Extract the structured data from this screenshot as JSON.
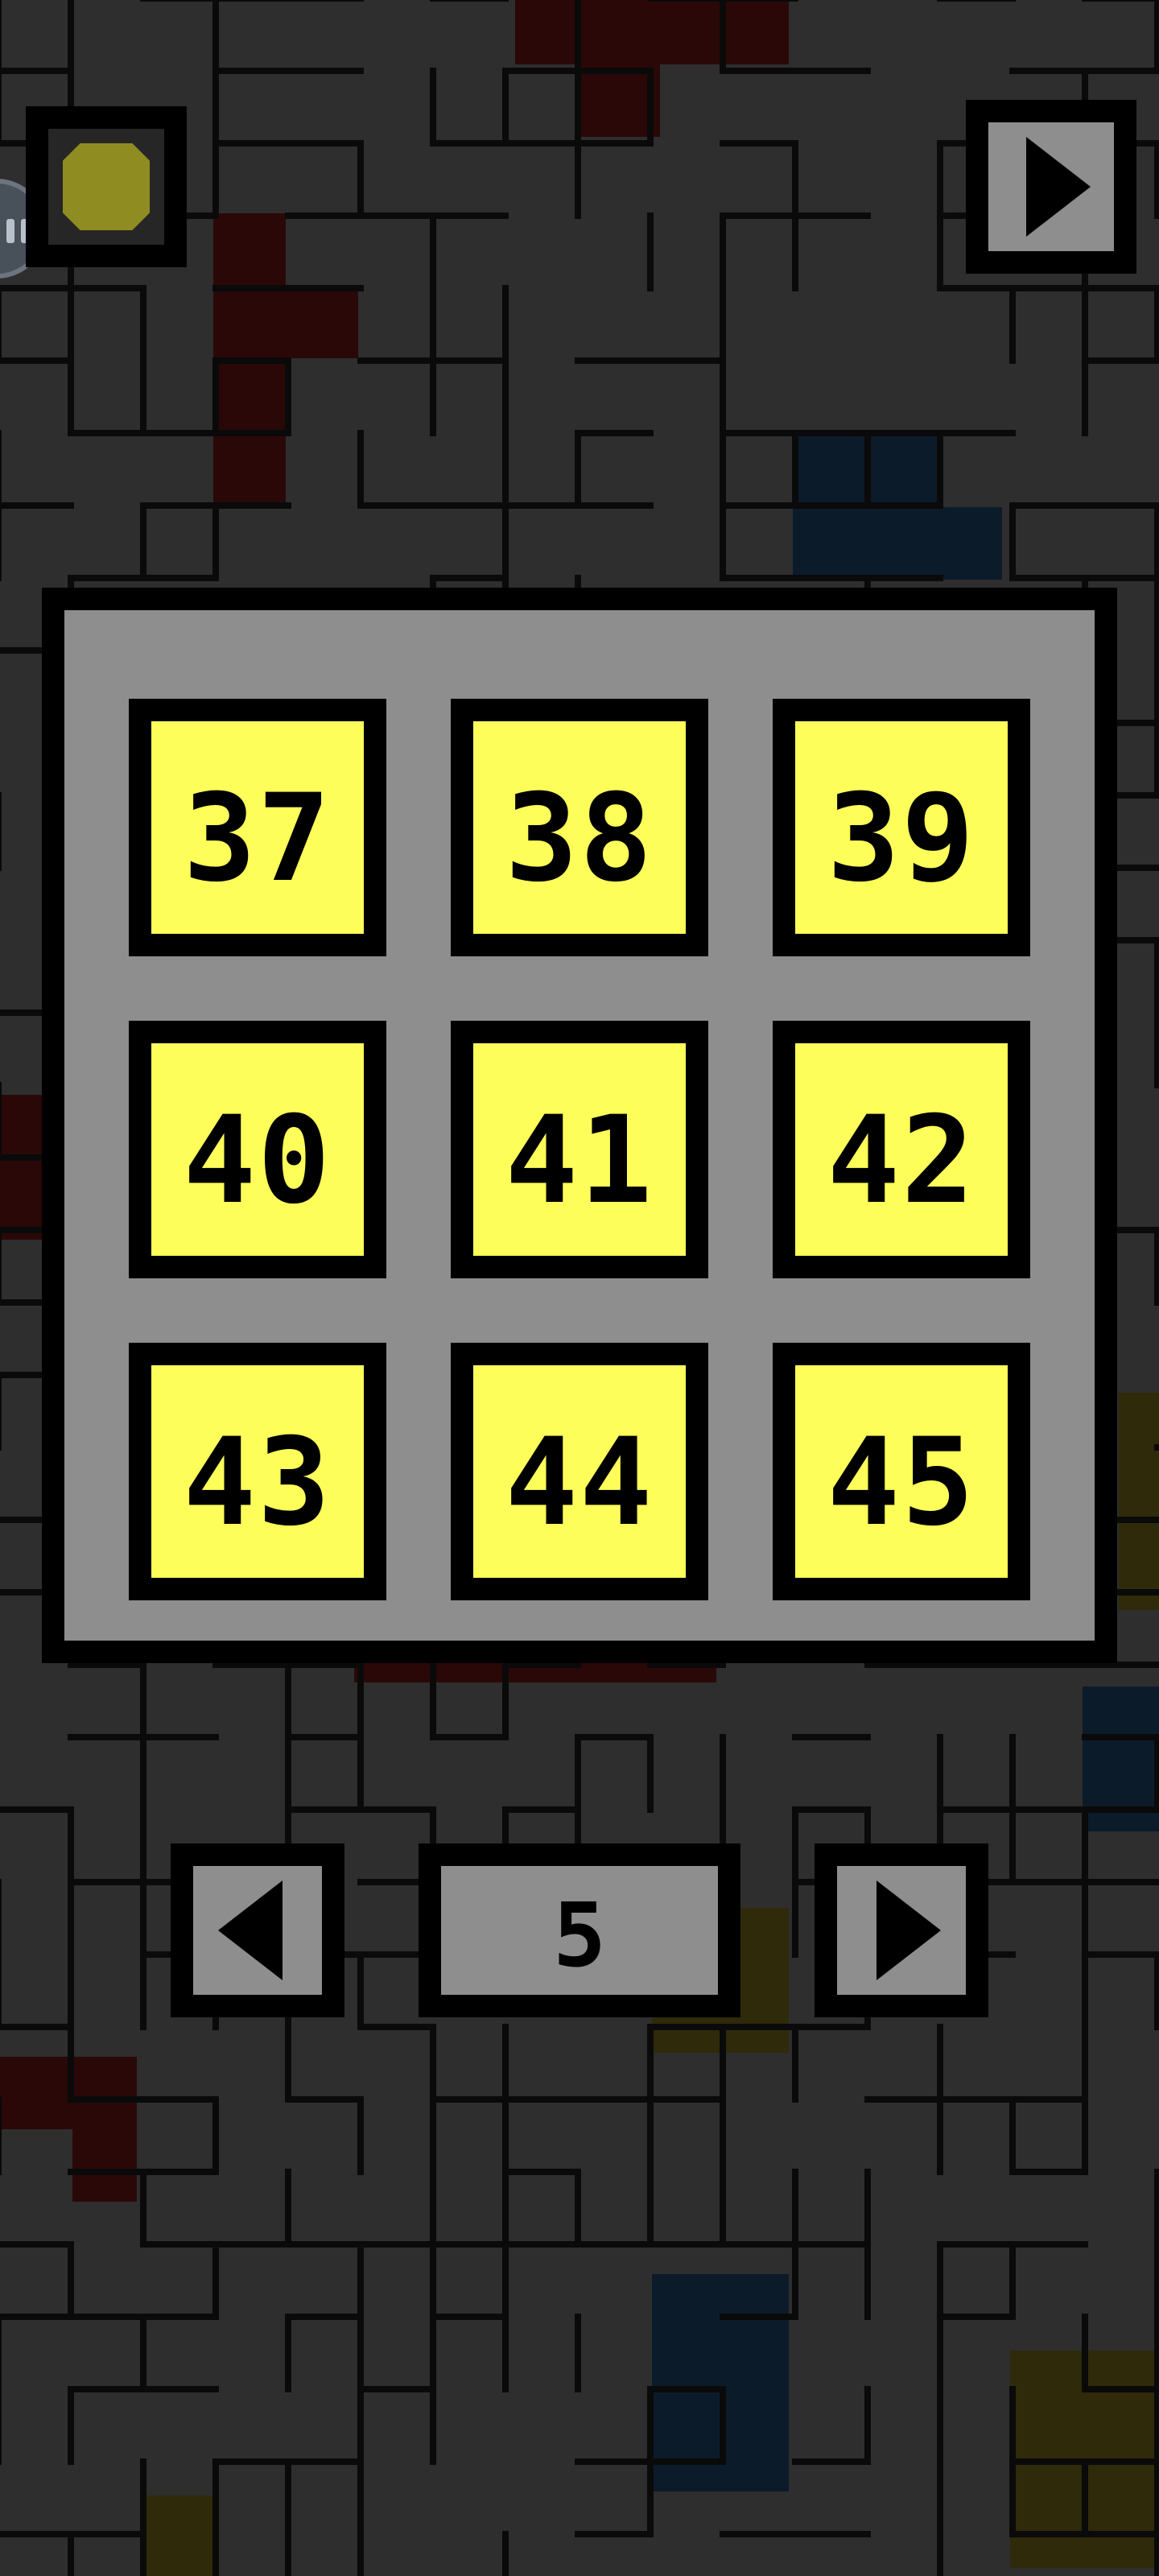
{
  "colors": {
    "background": "#2e2e2e",
    "level_tile": "#fefe5a",
    "panel": "#8e8e8e",
    "coin": "#8f8d22",
    "piece_red": "#2a0808",
    "piece_blue": "#0c1b2a",
    "piece_yellow": "#2e2a0a"
  },
  "icons": {
    "coin": "coin-icon",
    "play": "play-icon",
    "prev": "arrow-left-icon",
    "next": "arrow-right-icon",
    "assistant": "bot-icon"
  },
  "level_select": {
    "levels": [
      "37",
      "38",
      "39",
      "40",
      "41",
      "42",
      "43",
      "44",
      "45"
    ]
  },
  "pagination": {
    "current_page": "5"
  }
}
